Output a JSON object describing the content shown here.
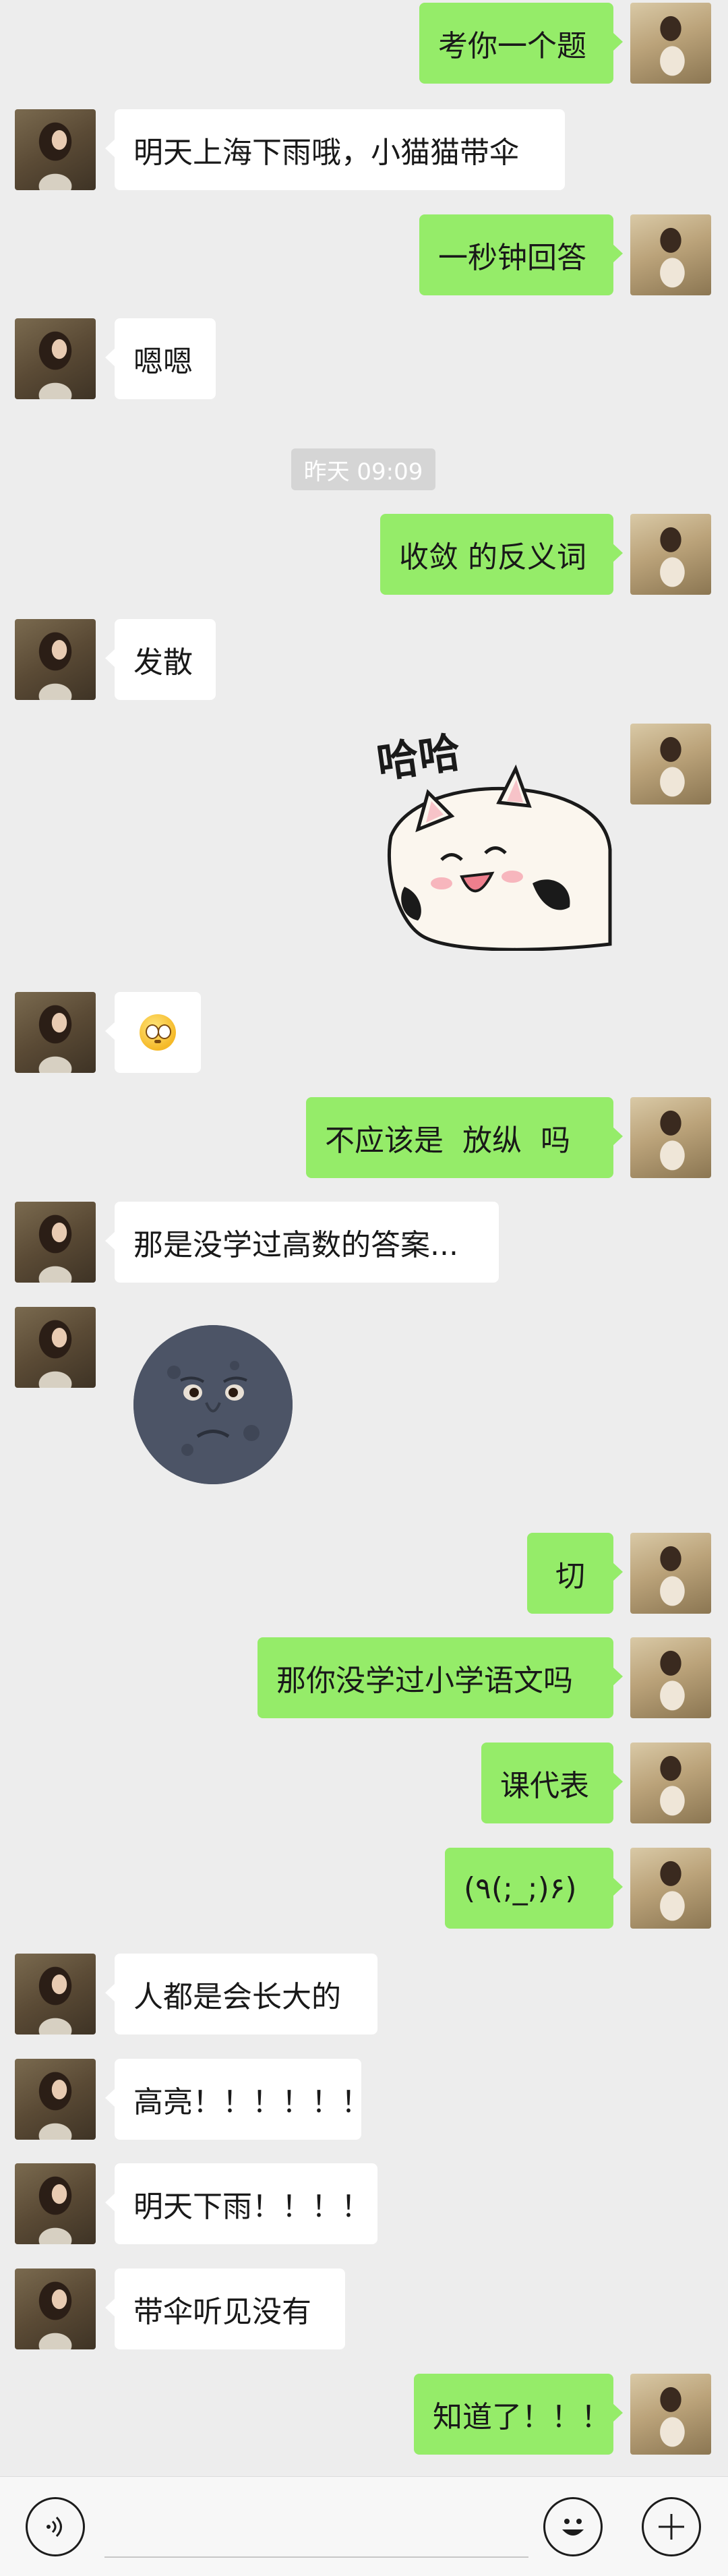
{
  "messages": [
    {
      "sender": "me",
      "text": "考你一个题"
    },
    {
      "sender": "other",
      "text": "明天上海下雨哦，小猫猫带伞"
    },
    {
      "sender": "me",
      "text": "一秒钟回答"
    },
    {
      "sender": "other",
      "text": "嗯嗯"
    },
    {
      "sender": "me",
      "text": "收敛 的反义词"
    },
    {
      "sender": "other",
      "text": "发散"
    },
    {
      "sender": "me",
      "sticker": "cat-laughing-sticker",
      "sticker_text": "哈哈"
    },
    {
      "sender": "other",
      "emoji": "flushed-face-emoji"
    },
    {
      "sender": "me",
      "text": "不应该是  放纵  吗"
    },
    {
      "sender": "other",
      "text": "那是没学过高数的答案..."
    },
    {
      "sender": "other",
      "sticker": "new-moon-face-sticker"
    },
    {
      "sender": "me",
      "text": "切"
    },
    {
      "sender": "me",
      "text": "那你没学过小学语文吗"
    },
    {
      "sender": "me",
      "text": "课代表"
    },
    {
      "sender": "me",
      "text": "(٩(;_;)۶)"
    },
    {
      "sender": "other",
      "text": "人都是会长大的"
    },
    {
      "sender": "other",
      "text": "高亮！！！！！！"
    },
    {
      "sender": "other",
      "text": "明天下雨！！！！"
    },
    {
      "sender": "other",
      "text": "带伞听见没有"
    },
    {
      "sender": "me",
      "text": "知道了！！！"
    }
  ],
  "timestamp": "昨天 09:09",
  "input_bar": {
    "voice_icon": "voice-icon",
    "emoji_icon": "emoji-icon",
    "plus_icon": "plus-icon"
  },
  "colors": {
    "background": "#ededed",
    "my_bubble": "#95ec69",
    "other_bubble": "#ffffff"
  }
}
